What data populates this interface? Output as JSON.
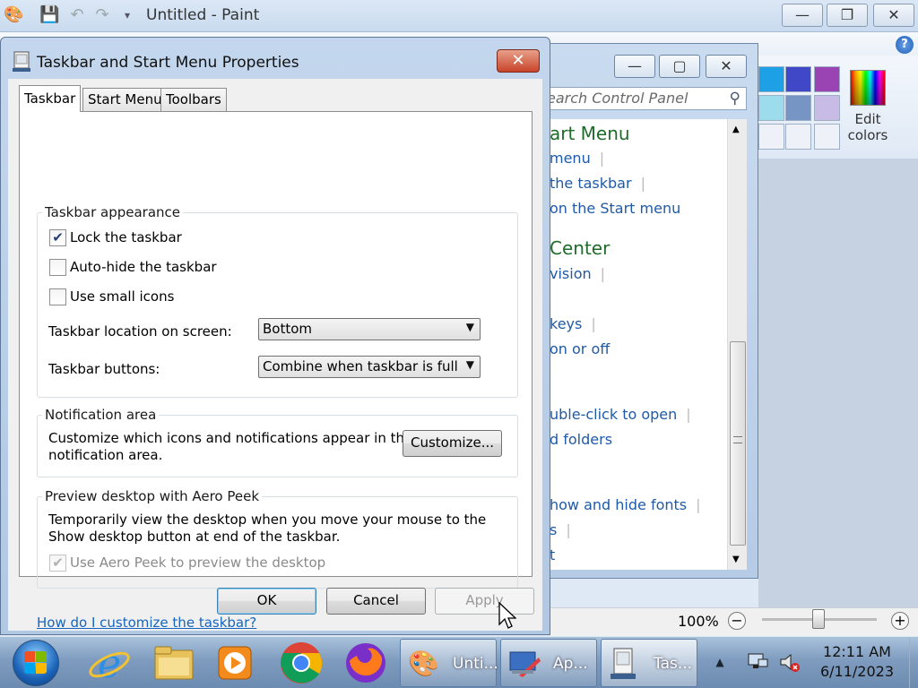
{
  "paint": {
    "title": "Untitled - Paint",
    "minimize": "—",
    "maximize": "❐",
    "close": "✕",
    "help": "?",
    "edit_colors": "Edit colors",
    "zoom": "100%",
    "zoom_out": "−",
    "zoom_in": "+",
    "swatches": [
      "#1ea0e6",
      "#4048c8",
      "#9a44b4",
      "#9cdcec",
      "#7694c4",
      "#c8bce6",
      "#eef2f8",
      "#eef2f8",
      "#eef2f8"
    ]
  },
  "control_panel": {
    "minimize": "—",
    "maximize": "▢",
    "close": "✕",
    "search_placeholder": "earch Control Panel",
    "items": [
      {
        "text": "art Menu",
        "kind": "head"
      },
      {
        "text": "menu",
        "kind": "link"
      },
      {
        "text": "the taskbar",
        "kind": "link"
      },
      {
        "text": "on the Start menu",
        "kind": "link"
      },
      {
        "text": "Center",
        "kind": "head"
      },
      {
        "text": "vision",
        "kind": "link"
      },
      {
        "text": "keys",
        "kind": "link"
      },
      {
        "text": "on or off",
        "kind": "link"
      },
      {
        "text": "uble-click to open",
        "kind": "link"
      },
      {
        "text": "d folders",
        "kind": "link"
      },
      {
        "text": "how and hide fonts",
        "kind": "link"
      },
      {
        "text": "s",
        "kind": "link"
      },
      {
        "text": "t",
        "kind": "link"
      }
    ]
  },
  "dialog": {
    "title": "Taskbar and Start Menu Properties",
    "close": "✕",
    "tabs": [
      "Taskbar",
      "Start Menu",
      "Toolbars"
    ],
    "appearance": {
      "title": "Taskbar appearance",
      "lock_label": "Lock the taskbar",
      "lock_checked": true,
      "autohide_label": "Auto-hide the taskbar",
      "autohide_checked": false,
      "small_icons_label": "Use small icons",
      "small_icons_checked": false,
      "location_label": "Taskbar location on screen:",
      "location_value": "Bottom",
      "buttons_label": "Taskbar buttons:",
      "buttons_value": "Combine when taskbar is full"
    },
    "notification": {
      "title": "Notification area",
      "text_line1": "Customize which icons and notifications appear in the",
      "text_line2": "notification area.",
      "customize_button": "Customize..."
    },
    "peek": {
      "title": "Preview desktop with Aero Peek",
      "text_line1": "Temporarily view the desktop when you move your mouse to the",
      "text_line2": "Show desktop button at end of the taskbar.",
      "use_label": "Use Aero Peek to preview the desktop",
      "use_checked": true
    },
    "help_link": "How do I customize the taskbar?",
    "ok": "OK",
    "cancel": "Cancel",
    "apply": "Apply"
  },
  "taskbar": {
    "buttons": [
      {
        "label": "Unti..."
      },
      {
        "label": "Ap..."
      },
      {
        "label": "Tas..."
      }
    ],
    "tray_arrow": "▲",
    "time": "12:11 AM",
    "date": "6/11/2023"
  }
}
